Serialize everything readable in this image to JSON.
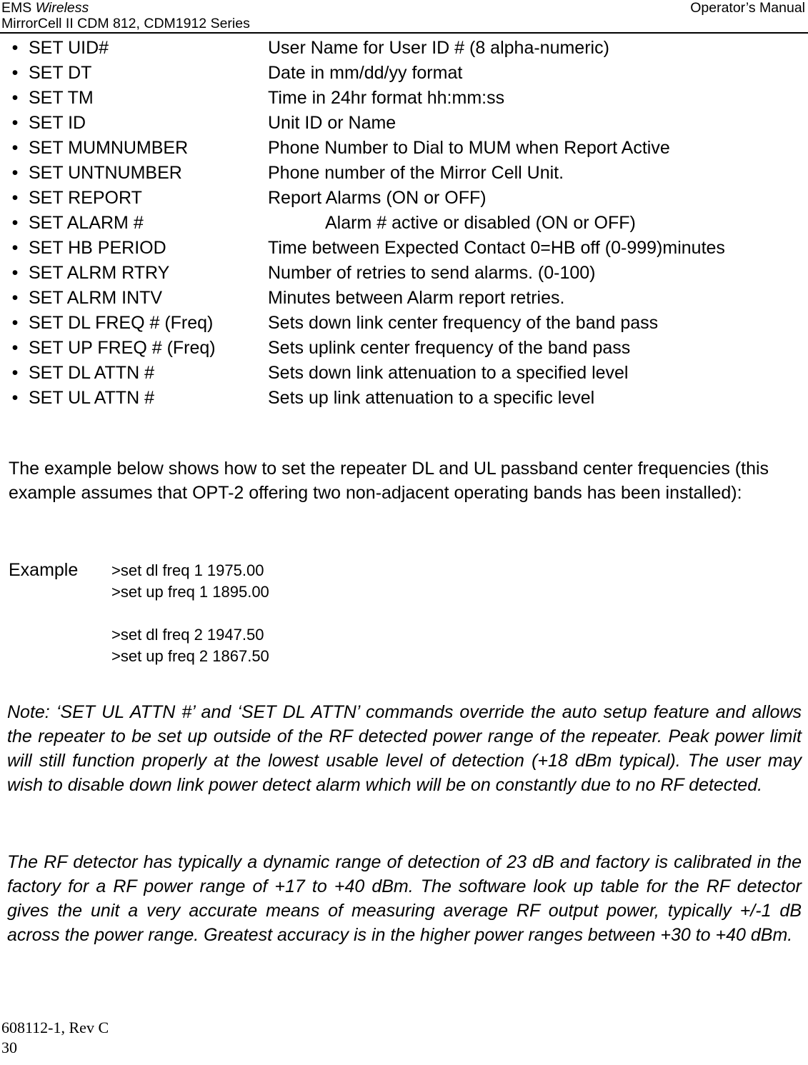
{
  "header": {
    "company_prefix": "EMS ",
    "company_italic": "Wireless",
    "product_line": "MirrorCell II CDM 812, CDM1912 Series",
    "manual_type": "Operator’s Manual"
  },
  "commands": {
    "bullet_glyph": "•",
    "items": [
      {
        "name": "SET UID#",
        "desc": "User Name for User ID # (8 alpha-numeric)",
        "indented": false
      },
      {
        "name": "SET DT",
        "desc": "Date in mm/dd/yy format",
        "indented": false
      },
      {
        "name": "SET TM",
        "desc": "Time in 24hr format hh:mm:ss",
        "indented": false
      },
      {
        "name": "SET ID",
        "desc": "Unit ID or Name",
        "indented": false
      },
      {
        "name": "SET MUMNUMBER",
        "desc": "Phone Number to Dial to MUM when Report Active",
        "indented": false
      },
      {
        "name": "SET UNTNUMBER",
        "desc": "Phone number of the Mirror Cell Unit.",
        "indented": false
      },
      {
        "name": "SET REPORT",
        "desc": "Report Alarms (ON or OFF)",
        "indented": false
      },
      {
        "name": "SET ALARM #",
        "desc": "Alarm # active or disabled (ON or OFF)",
        "indented": true
      },
      {
        "name": "SET HB PERIOD",
        "desc": "Time between Expected Contact 0=HB off (0-999)minutes",
        "indented": false
      },
      {
        "name": "SET ALRM RTRY",
        "desc": "Number of retries to send alarms. (0-100)",
        "indented": false
      },
      {
        "name": "SET ALRM INTV",
        "desc": "Minutes between Alarm report retries.",
        "indented": false
      },
      {
        "name": "SET DL FREQ # (Freq)",
        "desc": "Sets down link center frequency of the band pass",
        "indented": false
      },
      {
        "name": "SET UP FREQ # (Freq)",
        "desc": "Sets uplink center frequency of the band pass",
        "indented": false
      },
      {
        "name": "SET DL ATTN #",
        "desc": "Sets down link attenuation to a specified level",
        "indented": false
      },
      {
        "name": "SET UL ATTN #",
        "desc": "Sets up link attenuation to a specific level",
        "indented": false
      }
    ]
  },
  "intro_paragraph": "The example below shows how to set the repeater DL and UL passband center frequencies (this example assumes that OPT-2 offering two non-adjacent operating bands has been installed):",
  "example": {
    "label": "Example",
    "lines": [
      ">set dl freq 1 1975.00",
      ">set up freq 1 1895.00",
      "",
      ">set dl freq 2 1947.50",
      ">set up freq 2 1867.50"
    ]
  },
  "note_paragraph": "Note:  ‘SET UL ATTN #’ and ‘SET DL ATTN’ commands override the auto setup feature and allows the repeater to be set up outside of the RF detected power range of the repeater.  Peak power limit will still function properly at the lowest usable level of detection (+18 dBm typical).  The user may wish to disable down link power detect alarm which will be on constantly due to no RF detected.",
  "detector_paragraph": "The RF detector has typically a dynamic range of detection of 23 dB and factory is calibrated in the factory for a RF power range of +17 to +40 dBm.  The software look up table for the RF detector gives the unit a very accurate means of measuring average RF output power, typically +/-1 dB across the power range.  Greatest accuracy is in the higher power ranges between +30 to +40 dBm.",
  "footer": {
    "doc_code": "608112-1, Rev C",
    "page_number": "30"
  }
}
